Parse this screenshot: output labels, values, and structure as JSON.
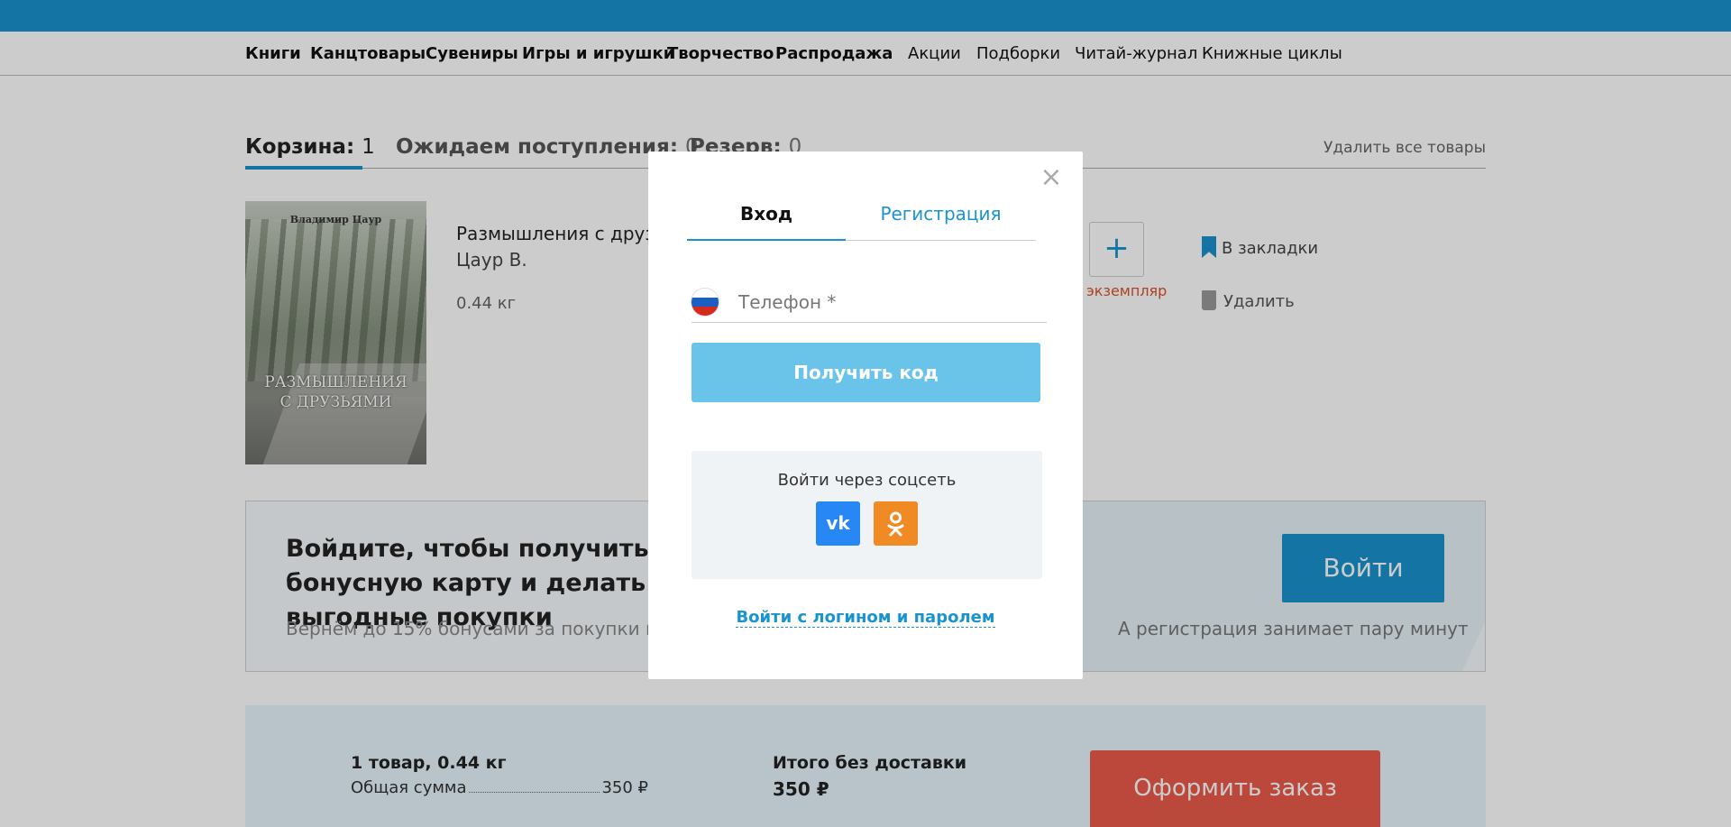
{
  "nav": {
    "categories": [
      "Книги",
      "Канцтовары",
      "Сувениры",
      "Игры и игрушки",
      "Творчество",
      "Распродажа"
    ],
    "sections": [
      "Акции",
      "Подборки",
      "Читай-журнал",
      "Книжные циклы"
    ]
  },
  "basket": {
    "tabs": [
      {
        "label": "Корзина:",
        "count": "1"
      },
      {
        "label": "Ожидаем поступления:",
        "count": "0"
      },
      {
        "label": "Резерв:",
        "count": "0"
      }
    ],
    "delete_all": "Удалить все товары"
  },
  "product": {
    "cover_author": "Владимир Цаур",
    "cover_title_line1": "РАЗМЫШЛЕНИЯ",
    "cover_title_line2": "С ДРУЗЬЯМИ",
    "title": "Размышления с друзьями",
    "author": "Цаур В.",
    "weight": "0.44 кг",
    "qty_plus": "+",
    "qty_note": "экземпляр",
    "bookmark": "В закладки",
    "remove": "Удалить"
  },
  "bonus": {
    "title": "Войдите, чтобы получить бонусную карту и делать выгодные покупки",
    "subtitle": "Вернём до 15% бонусами за покупки в магазине",
    "login_button": "Войти",
    "note": "А регистрация занимает пару минут"
  },
  "summary": {
    "count": "1 товар, 0.44 кг",
    "total_label": "Общая сумма",
    "total_value": "350 ₽",
    "no_delivery_label": "Итого без доставки",
    "no_delivery_value": "350 ₽",
    "checkout": "Оформить заказ"
  },
  "modal": {
    "close": "×",
    "tab_login": "Вход",
    "tab_register": "Регистрация",
    "phone_placeholder": "Телефон *",
    "get_code": "Получить код",
    "social_label": "Войти через соцсеть",
    "vk_icon": "vk",
    "ok_icon": "ok",
    "password_link": "Войти с логином и паролем"
  },
  "colors": {
    "accent": "#1a93cf",
    "button_disabled": "#6ac3e8",
    "checkout": "#ea5b4a",
    "vk": "#2787f5",
    "ok": "#f08a24"
  }
}
